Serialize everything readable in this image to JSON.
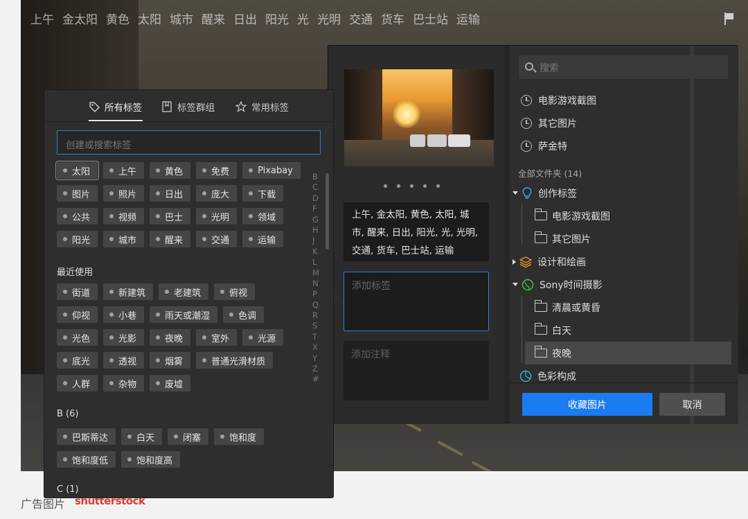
{
  "background": {
    "top_tags": [
      "上午",
      "金太阳",
      "黄色",
      "太阳",
      "城市",
      "醒来",
      "日出",
      "阳光",
      "光",
      "光明",
      "交通",
      "货车",
      "巴士站",
      "运输"
    ],
    "flag_icon": "flag-icon",
    "ad_label": "广告图片",
    "ad_brand": "shutterstock"
  },
  "tag_panel": {
    "tabs": [
      {
        "label": "所有标签",
        "icon": "tag-icon"
      },
      {
        "label": "标签群组",
        "icon": "bookmark-icon"
      },
      {
        "label": "常用标签",
        "icon": "star-icon"
      }
    ],
    "search_placeholder": "创建或搜索标签",
    "current_tags": [
      [
        "太阳",
        "上午",
        "黄色",
        "免费",
        "Pixabay"
      ],
      [
        "图片",
        "照片",
        "日出",
        "庞大",
        "下载"
      ],
      [
        "公共",
        "视频",
        "巴士",
        "光明",
        "领域"
      ],
      [
        "阳光",
        "城市",
        "醒来",
        "交通",
        "运输"
      ]
    ],
    "recent_label": "最近使用",
    "recent_tags": [
      [
        "街道",
        "新建筑",
        "老建筑",
        "俯视"
      ],
      [
        "仰视",
        "小巷",
        "雨天或潮湿",
        "色调"
      ],
      [
        "光色",
        "光影",
        "夜晚",
        "室外",
        "光源"
      ],
      [
        "底光",
        "透视",
        "烟雾",
        "普通光滑材质"
      ],
      [
        "人群",
        "杂物",
        "废墟"
      ]
    ],
    "group_b_label": "B (6)",
    "group_b_tags": [
      [
        "巴斯蒂达",
        "白天",
        "闭塞",
        "饱和度"
      ],
      [
        "饱和度低",
        "饱和度高"
      ]
    ],
    "group_c_label": "C (1)",
    "alphabet": [
      "B",
      "C",
      "D",
      "F",
      "G",
      "H",
      "J",
      "K",
      "L",
      "M",
      "N",
      "P",
      "Q",
      "R",
      "S",
      "T",
      "X",
      "Y",
      "Z",
      "#"
    ]
  },
  "save_dialog": {
    "tag_text": "上午, 金太阳, 黄色, 太阳, 城市, 醒来, 日出, 阳光, 光, 光明, 交通, 货车, 巴士站, 运输",
    "add_tag_placeholder": "添加标签",
    "add_note_placeholder": "添加注释",
    "folder_search_placeholder": "搜索",
    "recent_folders": [
      "电影游戏截图",
      "其它图片",
      "萨金特"
    ],
    "all_folders_label": "全部文件夹 (14)",
    "folders": {
      "creative_tags": "创作标签",
      "creative_children": [
        "电影游戏截图",
        "其它图片"
      ],
      "design_drawing": "设计和绘画",
      "sony": "Sony时间摄影",
      "sony_children": [
        "清晨或黄昏",
        "白天",
        "夜晚"
      ],
      "color_composition": "色彩构成"
    },
    "save_label": "收藏图片",
    "cancel_label": "取消",
    "accent_color": "#1a7cf0"
  }
}
